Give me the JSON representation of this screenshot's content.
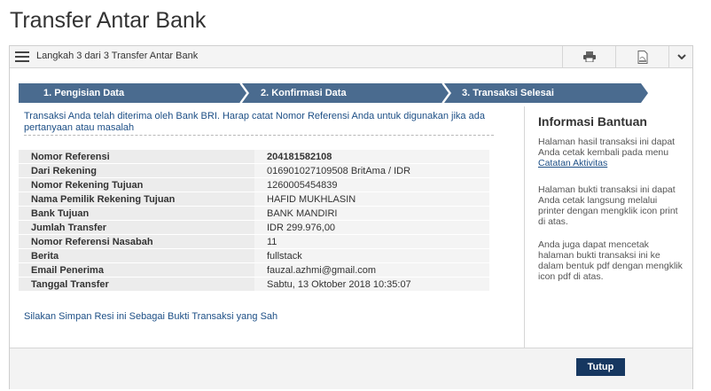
{
  "page": {
    "title": "Transfer Antar Bank"
  },
  "header": {
    "step_text": "Langkah 3 dari 3 Transfer Antar Bank"
  },
  "steps": [
    {
      "label": "1. Pengisian Data"
    },
    {
      "label": "2. Konfirmasi Data"
    },
    {
      "label": "3. Transaksi Selesai"
    }
  ],
  "notice": "Transaksi Anda telah diterima oleh Bank BRI. Harap catat Nomor Referensi Anda untuk digunakan jika ada pertanyaan atau masalah",
  "details": [
    {
      "label": "Nomor Referensi",
      "value": "204181582108"
    },
    {
      "label": "Dari Rekening",
      "value": "016901027109508 BritAma / IDR"
    },
    {
      "label": "Nomor Rekening Tujuan",
      "value": "1260005454839"
    },
    {
      "label": "Nama Pemilik Rekening Tujuan",
      "value": "HAFID MUKHLASIN"
    },
    {
      "label": "Bank Tujuan",
      "value": "BANK MANDIRI"
    },
    {
      "label": "Jumlah Transfer",
      "value": "IDR 299.976,00"
    },
    {
      "label": "Nomor Referensi Nasabah",
      "value": "11"
    },
    {
      "label": "Berita",
      "value": "fullstack"
    },
    {
      "label": "Email Penerima",
      "value": "fauzal.azhmi@gmail.com"
    },
    {
      "label": "Tanggal Transfer",
      "value": "Sabtu, 13 Oktober 2018 10:35:07"
    }
  ],
  "save_note": "Silakan Simpan Resi ini Sebagai Bukti Transaksi yang Sah",
  "sidebar": {
    "title": "Informasi Bantuan",
    "p1_prefix": "Halaman hasil transaksi ini dapat Anda cetak kembali pada menu ",
    "p1_link": "Catatan Aktivitas",
    "p2": "Halaman bukti transaksi ini dapat Anda cetak langsung melalui printer dengan mengklik icon print di atas.",
    "p3": "Anda juga dapat mencetak halaman bukti transaksi ini ke dalam bentuk pdf dengan mengklik icon pdf di atas."
  },
  "footer": {
    "close_label": "Tutup"
  },
  "colors": {
    "step_bg": "#4a6b8f",
    "link": "#1d4f86",
    "button": "#163760"
  },
  "icons": {
    "menu": "hamburger-icon",
    "print": "printer-icon",
    "pdf": "pdf-icon",
    "more": "chevron-down-icon"
  }
}
